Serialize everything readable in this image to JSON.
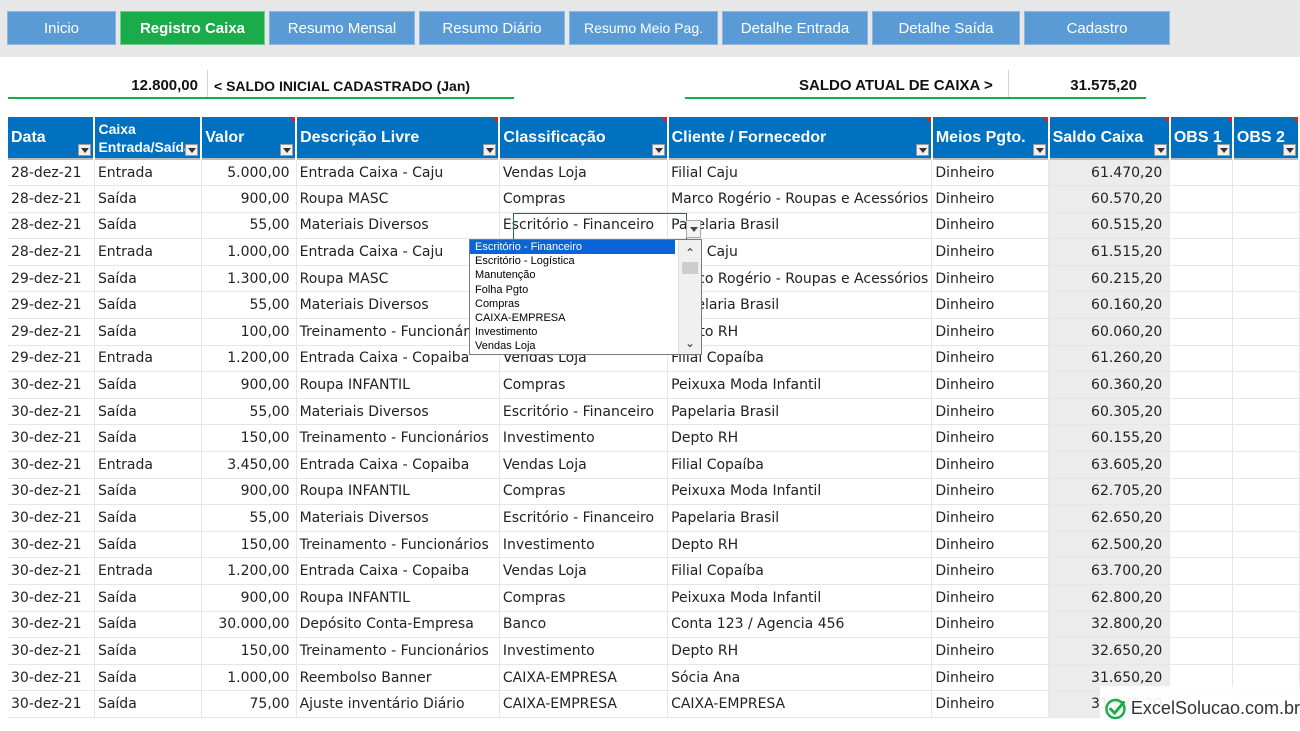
{
  "nav": [
    {
      "label": "Inicio",
      "active": false
    },
    {
      "label": "Registro Caixa",
      "active": true
    },
    {
      "label": "Resumo Mensal",
      "active": false
    },
    {
      "label": "Resumo Diário",
      "active": false
    },
    {
      "label": "Resumo Meio Pag.",
      "active": false
    },
    {
      "label": "Detalhe Entrada",
      "active": false
    },
    {
      "label": "Detalhe Saída",
      "active": false
    },
    {
      "label": "Cadastro",
      "active": false
    }
  ],
  "summary": {
    "initial_value": "12.800,00",
    "initial_label": "< SALDO INICIAL CADASTRADO (Jan)",
    "current_label": "SALDO ATUAL DE CAIXA >",
    "current_value": "31.575,20"
  },
  "headers": [
    "Data",
    "Caixa Entrada/Saída",
    "Valor",
    "Descrição Livre",
    "Classificação",
    "Cliente / Fornecedor",
    "Meios Pgto.",
    "Saldo Caixa",
    "OBS 1",
    "OBS 2"
  ],
  "header_caixa_line1": "Caixa",
  "header_caixa_line2": "Entrada/Saída",
  "rows": [
    [
      "28-dez-21",
      "Entrada",
      "5.000,00",
      "Entrada Caixa - Caju",
      "Vendas Loja",
      "Filial Caju",
      "Dinheiro",
      "61.470,20"
    ],
    [
      "28-dez-21",
      "Saída",
      "900,00",
      "Roupa MASC",
      "Compras",
      "Marco Rogério - Roupas e Acessórios",
      "Dinheiro",
      "60.570,20"
    ],
    [
      "28-dez-21",
      "Saída",
      "55,00",
      "Materiais Diversos",
      "Escritório - Financeiro",
      "Papelaria Brasil",
      "Dinheiro",
      "60.515,20"
    ],
    [
      "28-dez-21",
      "Entrada",
      "1.000,00",
      "Entrada Caixa - Caju",
      "Vendas Loja",
      "Filial Caju",
      "Dinheiro",
      "61.515,20"
    ],
    [
      "29-dez-21",
      "Saída",
      "1.300,00",
      "Roupa MASC",
      "Compras",
      "Marco Rogério - Roupas e Acessórios",
      "Dinheiro",
      "60.215,20"
    ],
    [
      "29-dez-21",
      "Saída",
      "55,00",
      "Materiais Diversos",
      "Escritório - Financeiro",
      "Papelaria Brasil",
      "Dinheiro",
      "60.160,20"
    ],
    [
      "29-dez-21",
      "Saída",
      "100,00",
      "Treinamento - Funcionários",
      "Investimento",
      "Depto RH",
      "Dinheiro",
      "60.060,20"
    ],
    [
      "29-dez-21",
      "Entrada",
      "1.200,00",
      "Entrada Caixa - Copaiba",
      "Vendas Loja",
      "Filial Copaíba",
      "Dinheiro",
      "61.260,20"
    ],
    [
      "30-dez-21",
      "Saída",
      "900,00",
      "Roupa INFANTIL",
      "Compras",
      "Peixuxa Moda Infantil",
      "Dinheiro",
      "60.360,20"
    ],
    [
      "30-dez-21",
      "Saída",
      "55,00",
      "Materiais Diversos",
      "Escritório - Financeiro",
      "Papelaria Brasil",
      "Dinheiro",
      "60.305,20"
    ],
    [
      "30-dez-21",
      "Saída",
      "150,00",
      "Treinamento - Funcionários",
      "Investimento",
      "Depto RH",
      "Dinheiro",
      "60.155,20"
    ],
    [
      "30-dez-21",
      "Entrada",
      "3.450,00",
      "Entrada Caixa - Copaiba",
      "Vendas Loja",
      "Filial Copaíba",
      "Dinheiro",
      "63.605,20"
    ],
    [
      "30-dez-21",
      "Saída",
      "900,00",
      "Roupa INFANTIL",
      "Compras",
      "Peixuxa Moda Infantil",
      "Dinheiro",
      "62.705,20"
    ],
    [
      "30-dez-21",
      "Saída",
      "55,00",
      "Materiais Diversos",
      "Escritório - Financeiro",
      "Papelaria Brasil",
      "Dinheiro",
      "62.650,20"
    ],
    [
      "30-dez-21",
      "Saída",
      "150,00",
      "Treinamento - Funcionários",
      "Investimento",
      "Depto RH",
      "Dinheiro",
      "62.500,20"
    ],
    [
      "30-dez-21",
      "Entrada",
      "1.200,00",
      "Entrada Caixa - Copaiba",
      "Vendas Loja",
      "Filial Copaíba",
      "Dinheiro",
      "63.700,20"
    ],
    [
      "30-dez-21",
      "Saída",
      "900,00",
      "Roupa INFANTIL",
      "Compras",
      "Peixuxa Moda Infantil",
      "Dinheiro",
      "62.800,20"
    ],
    [
      "30-dez-21",
      "Saída",
      "30.000,00",
      "Depósito Conta-Empresa",
      "Banco",
      "Conta 123 / Agencia 456",
      "Dinheiro",
      "32.800,20"
    ],
    [
      "30-dez-21",
      "Saída",
      "150,00",
      "Treinamento - Funcionários",
      "Investimento",
      "Depto RH",
      "Dinheiro",
      "32.650,20"
    ],
    [
      "30-dez-21",
      "Saída",
      "1.000,00",
      "Reembolso Banner",
      "CAIXA-EMPRESA",
      "Sócia Ana",
      "Dinheiro",
      "31.650,20"
    ],
    [
      "30-dez-21",
      "Saída",
      "75,00",
      "Ajuste inventário Diário",
      "CAIXA-EMPRESA",
      "CAIXA-EMPRESA",
      "Dinheiro",
      "31.575,20"
    ]
  ],
  "dropdown": {
    "options": [
      "Escritório - Financeiro",
      "Escritório - Logística",
      "Manutenção",
      "Folha Pgto",
      "Compras",
      "CAIXA-EMPRESA",
      "Investimento",
      "Vendas Loja"
    ],
    "selected_index": 0
  },
  "watermark": "ExcelSolucao.com.br",
  "colors": {
    "nav": "#5b9bd5",
    "nav_active": "#1aab4b",
    "header": "#0070c0",
    "accent_line": "#1aab4b"
  }
}
